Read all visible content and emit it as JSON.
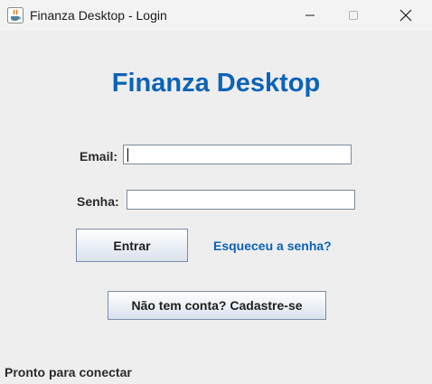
{
  "window": {
    "title": "Finanza Desktop - Login",
    "controls": {
      "minimize_icon": "minimize-icon",
      "maximize_icon": "maximize-icon",
      "close_icon": "close-icon"
    },
    "app_icon": "java-icon"
  },
  "main": {
    "app_title": "Finanza Desktop",
    "email": {
      "label": "Email:",
      "value": "",
      "placeholder": ""
    },
    "senha": {
      "label": "Senha:",
      "value": "",
      "placeholder": ""
    },
    "entrar_label": "Entrar",
    "forgot_label": "Esqueceu a senha?",
    "register_label": "Não tem conta? Cadastre-se"
  },
  "status": {
    "text": "Pronto para conectar"
  },
  "colors": {
    "accent": "#0b63b8",
    "background": "#eeeeee",
    "titlebar": "#f3f3f3"
  }
}
